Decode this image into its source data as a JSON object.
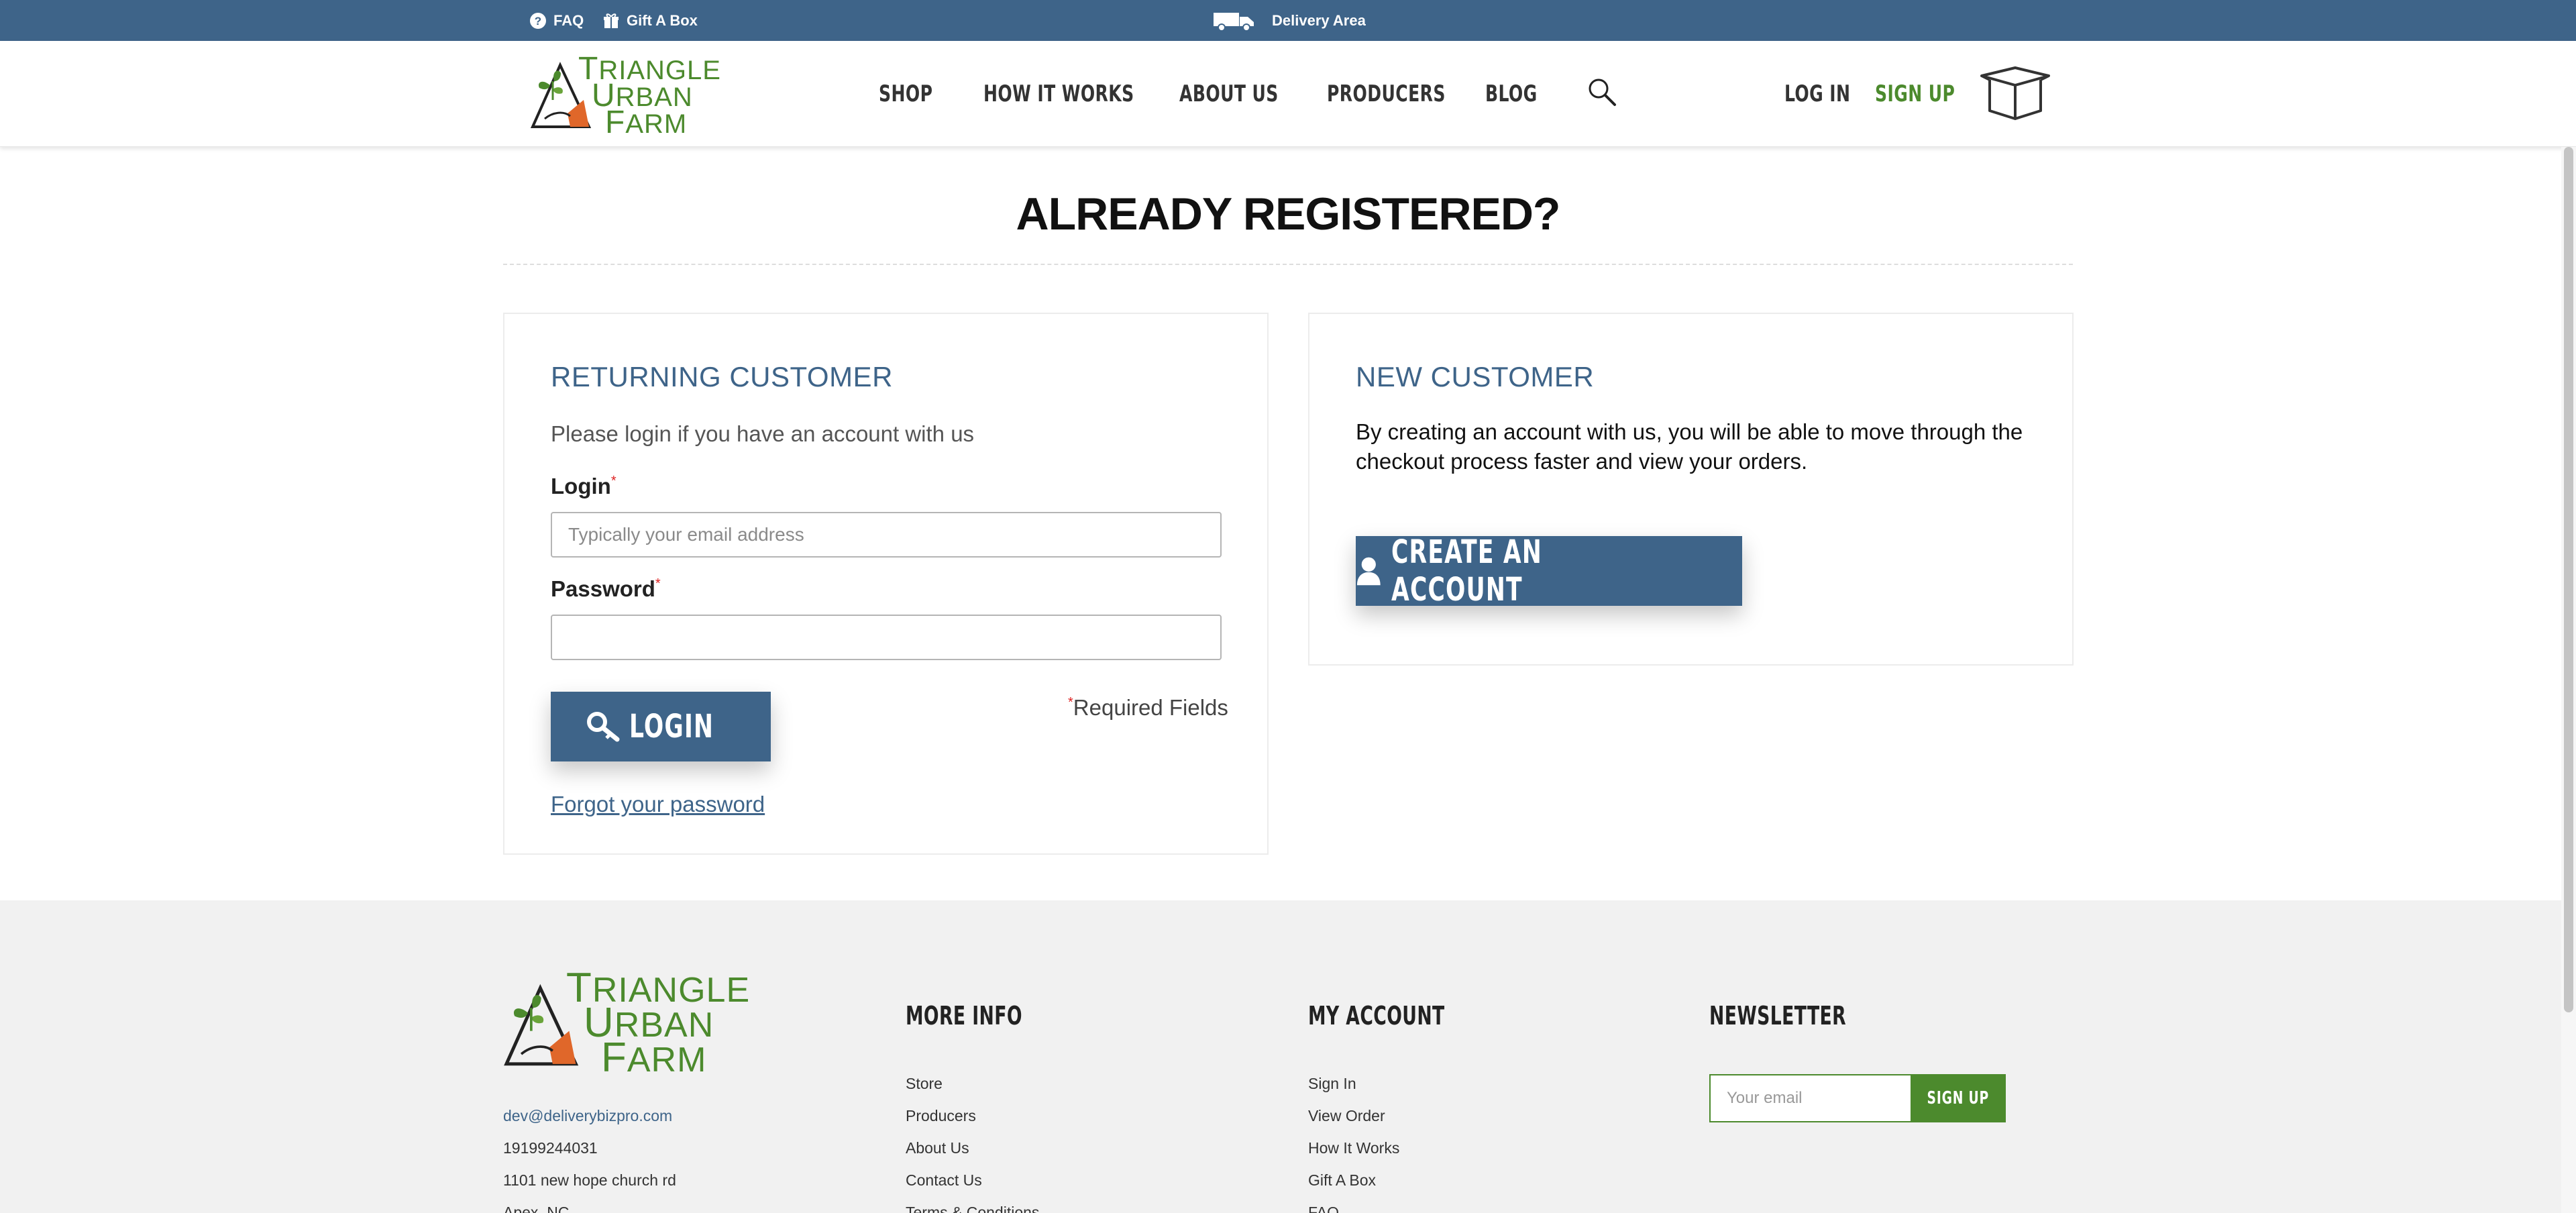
{
  "topbar": {
    "faq": "FAQ",
    "gift": "Gift A Box",
    "delivery": "Delivery Area",
    "icons": [
      "question-circle-icon",
      "gift-icon",
      "truck-icon"
    ],
    "background": "#3e6489"
  },
  "brand": {
    "line1_initial": "T",
    "line1_rest": "RIANGLE",
    "line2_initial": "U",
    "line2_rest": "RBAN",
    "line3_initial": "F",
    "line3_rest": "ARM",
    "accent": "#4c8a2d",
    "carrot": "#e0672a"
  },
  "nav": {
    "items": [
      "SHOP",
      "HOW IT WORKS",
      "ABOUT US",
      "PRODUCERS",
      "BLOG"
    ],
    "search_icon": "search-icon",
    "login": "LOG IN",
    "signup": "SIGN UP",
    "cart_icon": "box-icon"
  },
  "page": {
    "title": "ALREADY REGISTERED?"
  },
  "returning": {
    "title": "RETURNING CUSTOMER",
    "intro": "Please login if you have an account with us",
    "login_label": "Login",
    "login_placeholder": "Typically your email address",
    "login_value": "",
    "password_label": "Password",
    "password_value": "",
    "required_mark": "*",
    "login_button": "LOGIN",
    "login_button_icon": "key-icon",
    "required_note": "Required Fields",
    "forgot": "Forgot your password"
  },
  "new_customer": {
    "title": "NEW CUSTOMER",
    "text": "By creating an account with us, you will be able to move through the checkout process faster and view your orders.",
    "create_button": "CREATE AN ACCOUNT",
    "create_button_icon": "user-icon"
  },
  "footer": {
    "contact": {
      "email": "dev@deliverybizpro.com",
      "phone": "19199244031",
      "address1": "1101 new hope church rd",
      "address2": "Apex, NC"
    },
    "more_info": {
      "heading": "MORE INFO",
      "links": [
        "Store",
        "Producers",
        "About Us",
        "Contact Us",
        "Terms & Conditions"
      ]
    },
    "my_account": {
      "heading": "MY ACCOUNT",
      "links": [
        "Sign In",
        "View Order",
        "How It Works",
        "Gift A Box",
        "FAQ"
      ]
    },
    "newsletter": {
      "heading": "NEWSLETTER",
      "placeholder": "Your email",
      "value": "",
      "button": "SIGN UP"
    }
  }
}
